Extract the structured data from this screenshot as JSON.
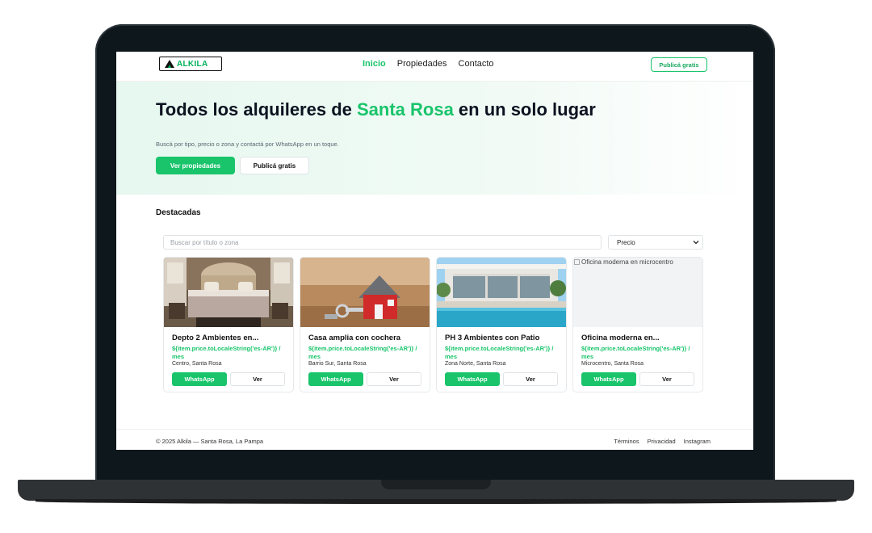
{
  "brand": {
    "name": "ALKILA",
    "accent": "#19c46b"
  },
  "nav": {
    "links": [
      {
        "label": "Inicio",
        "active": true
      },
      {
        "label": "Propiedades",
        "active": false
      },
      {
        "label": "Contacto",
        "active": false
      }
    ],
    "cta_label": "Publicá gratis"
  },
  "hero": {
    "title_pre": "Todos los alquileres de ",
    "title_accent": "Santa Rosa",
    "title_post": " en un solo lugar",
    "subtitle": "Buscá por tipo, precio o zona y contactá por WhatsApp en un toque.",
    "primary_button": "Ver propiedades",
    "secondary_button": "Publicá gratis"
  },
  "featured": {
    "title": "Destacadas",
    "search_placeholder": "Buscar por título o zona",
    "sort_selected": "Precio"
  },
  "cards": [
    {
      "title": "Depto 2 Ambientes en...",
      "price": "${item.price.toLocaleString('es-AR')} / mes",
      "location": "Centro, Santa Rosa",
      "image": "bedroom-photo",
      "image_alt": "",
      "whatsapp_label": "WhatsApp",
      "view_label": "Ver"
    },
    {
      "title": "Casa amplia con cochera",
      "price": "${item.price.toLocaleString('es-AR')} / mes",
      "location": "Barrio Sur, Santa Rosa",
      "image": "house-key-photo",
      "image_alt": "",
      "whatsapp_label": "WhatsApp",
      "view_label": "Ver"
    },
    {
      "title": "PH 3 Ambientes con Patio",
      "price": "${item.price.toLocaleString('es-AR')} / mes",
      "location": "Zona Norte, Santa Rosa",
      "image": "pool-house-photo",
      "image_alt": "",
      "whatsapp_label": "WhatsApp",
      "view_label": "Ver"
    },
    {
      "title": "Oficina moderna en...",
      "price": "${item.price.toLocaleString('es-AR')} / mes",
      "location": "Microcentro, Santa Rosa",
      "image": "broken-image",
      "image_alt": "Oficina moderna en microcentro",
      "whatsapp_label": "WhatsApp",
      "view_label": "Ver"
    }
  ],
  "footer": {
    "copyright": "© 2025 Alkila — Santa Rosa, La Pampa",
    "links": [
      "Términos",
      "Privacidad",
      "Instagram"
    ]
  }
}
